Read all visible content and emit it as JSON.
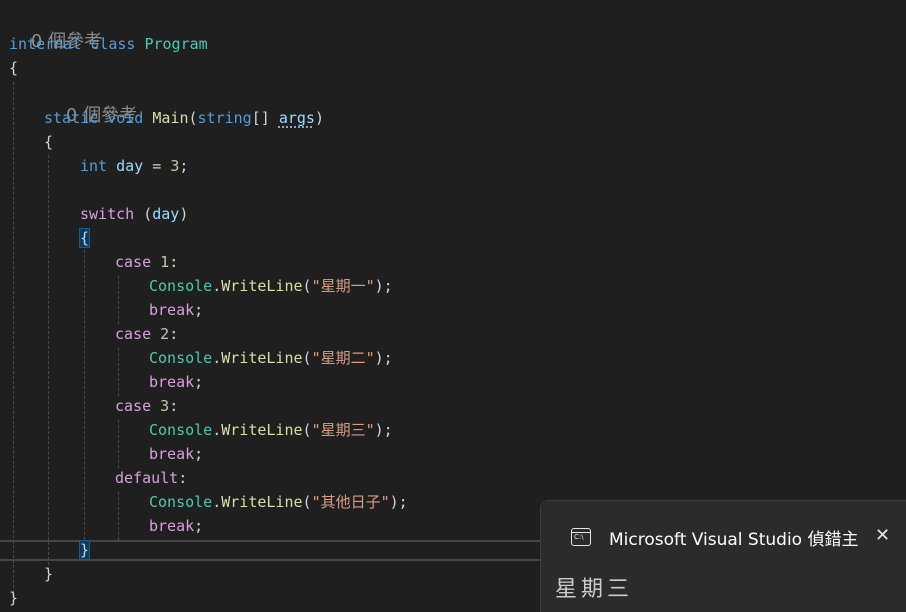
{
  "editor": {
    "codelens_class": "0 個參考",
    "codelens_method": "0 個參考",
    "kw_internal": "internal",
    "kw_class": "class",
    "class_name": "Program",
    "kw_static": "static",
    "kw_void": "void",
    "method_name": "Main",
    "kw_string": "string",
    "param_args": "args",
    "kw_int": "int",
    "var_day": "day",
    "value_day": "3",
    "kw_switch": "switch",
    "kw_case": "case",
    "kw_break": "break",
    "kw_default": "default",
    "type_console": "Console",
    "method_writeline": "WriteLine",
    "case1_value": "1",
    "case2_value": "2",
    "case3_value": "3",
    "str1": "\"星期一\"",
    "str2": "\"星期二\"",
    "str3": "\"星期三\"",
    "str_default": "\"其他日子\""
  },
  "console": {
    "title": "Microsoft Visual Studio 偵錯主",
    "icon_label": "C:\\",
    "output": "星期三"
  }
}
